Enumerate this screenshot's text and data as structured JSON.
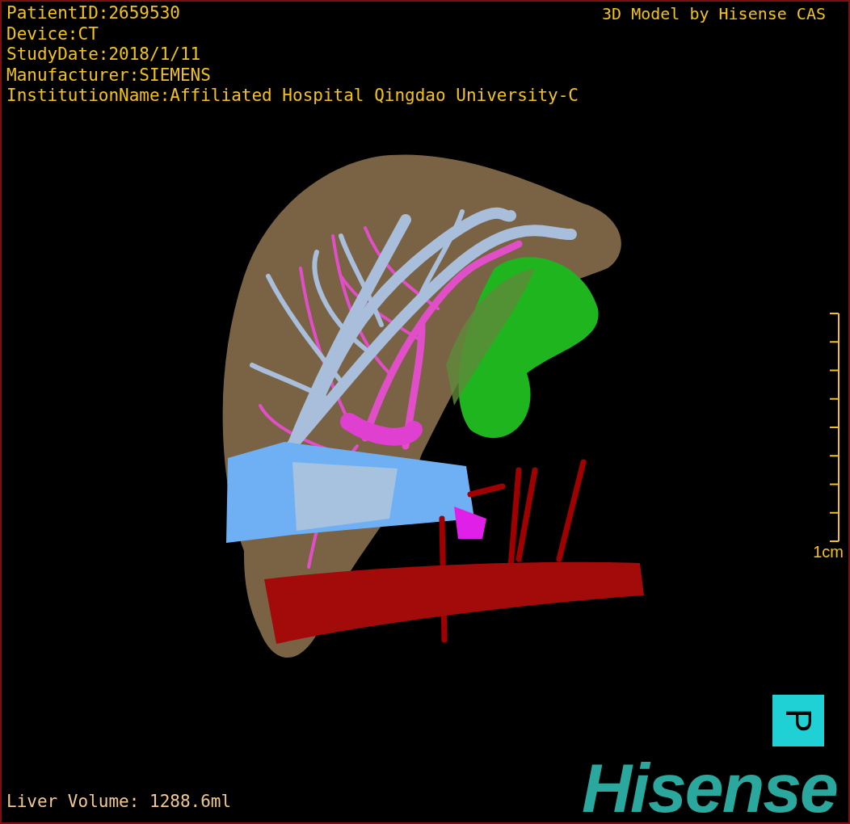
{
  "info_lines": [
    "PatientID:2659530",
    "Device:CT",
    "StudyDate:2018/1/11",
    "Manufacturer:SIEMENS",
    "InstitutionName:Affiliated Hospital Qingdao University-C"
  ],
  "credit": "3D Model by Hisense CAS",
  "scale_label": "1cm",
  "orientation_marker": "P",
  "liver_volume": "Liver Volume: 1288.6ml",
  "logo": "Hisense"
}
